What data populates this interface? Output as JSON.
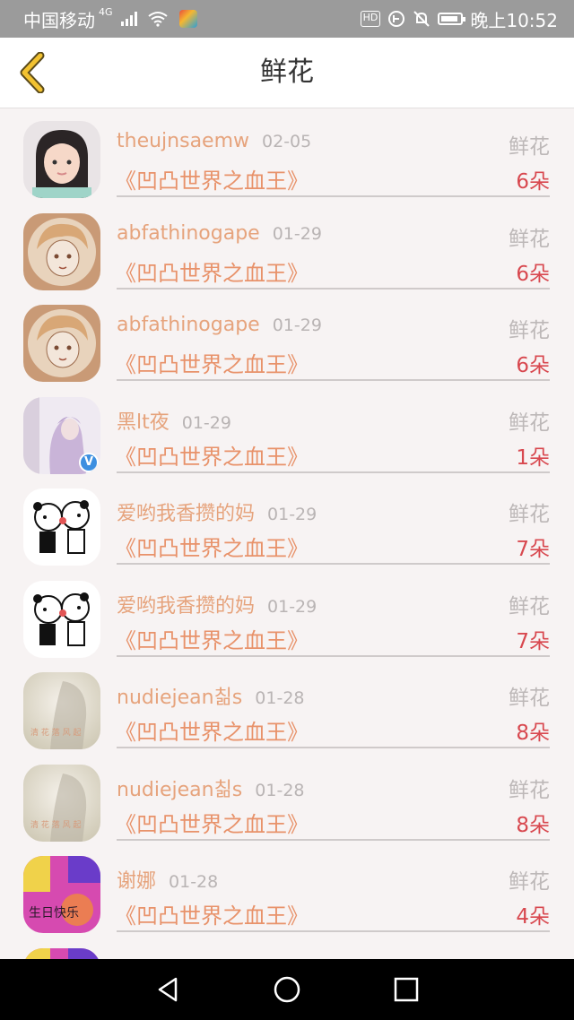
{
  "status_bar": {
    "carrier": "中国移动",
    "network": "4G",
    "hd": "HD",
    "time": "晚上10:52"
  },
  "header": {
    "title": "鲜花",
    "back_icon": "chevron-left-icon"
  },
  "colors": {
    "name": "#e6a37c",
    "book": "#e8926a",
    "count": "#d8484f",
    "accent_back": "#f2c230"
  },
  "items": [
    {
      "name": "theujnsaemw",
      "date": "02-05",
      "type": "鲜花",
      "book": "《凹凸世界之血王》",
      "count": "6朵",
      "avatar": "girl-photo",
      "verified": false
    },
    {
      "name": "abfathinogape",
      "date": "01-29",
      "type": "鲜花",
      "book": "《凹凸世界之血王》",
      "count": "6朵",
      "avatar": "anime-drawing",
      "verified": false
    },
    {
      "name": "abfathinogape",
      "date": "01-29",
      "type": "鲜花",
      "book": "《凹凸世界之血王》",
      "count": "6朵",
      "avatar": "anime-drawing",
      "verified": false
    },
    {
      "name": "黑lt夜",
      "date": "01-29",
      "type": "鲜花",
      "book": "《凹凸世界之血王》",
      "count": "1朵",
      "avatar": "purple-hair-girl",
      "verified": true
    },
    {
      "name": "爱哟我香攒的妈",
      "date": "01-29",
      "type": "鲜花",
      "book": "《凹凸世界之血王》",
      "count": "7朵",
      "avatar": "cartoon-bears",
      "verified": false
    },
    {
      "name": "爱哟我香攒的妈",
      "date": "01-29",
      "type": "鲜花",
      "book": "《凹凸世界之血王》",
      "count": "7朵",
      "avatar": "cartoon-bears",
      "verified": false
    },
    {
      "name": "nudiejean칢s",
      "date": "01-28",
      "type": "鲜花",
      "book": "《凹凸世界之血王》",
      "count": "8朵",
      "avatar": "faded-girl",
      "verified": false
    },
    {
      "name": "nudiejean칢s",
      "date": "01-28",
      "type": "鲜花",
      "book": "《凹凸世界之血王》",
      "count": "8朵",
      "avatar": "faded-girl",
      "verified": false
    },
    {
      "name": "谢娜",
      "date": "01-28",
      "type": "鲜花",
      "book": "《凹凸世界之血王》",
      "count": "4朵",
      "avatar": "colorful-text",
      "verified": false
    },
    {
      "name": "",
      "date": "",
      "type": "",
      "book": "",
      "count": "",
      "avatar": "colorful-text",
      "verified": false
    }
  ],
  "nav": {
    "back": "back-triangle-icon",
    "home": "home-circle-icon",
    "recents": "recents-square-icon"
  }
}
